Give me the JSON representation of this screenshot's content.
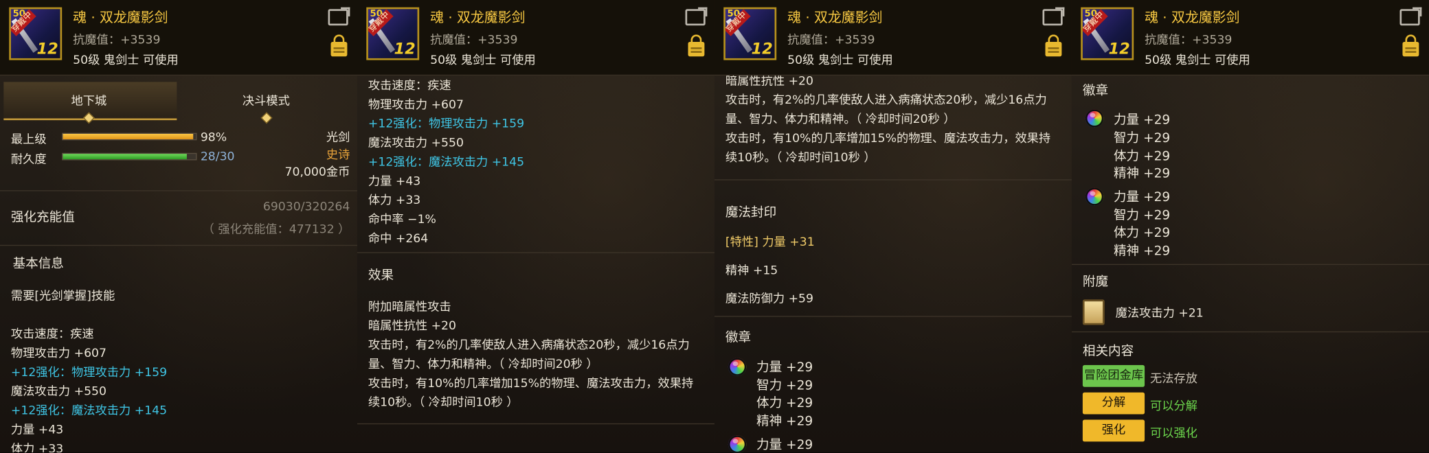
{
  "item": {
    "name": "魂 · 双龙魔影剑",
    "resist": "抗魔值：+3539",
    "requirement": "50级 鬼剑士 可使用",
    "icon_tag": "穿戴中",
    "icon_level": "12",
    "icon_req_level": "50"
  },
  "panel1": {
    "tabs": [
      "地下城",
      "决斗模式"
    ],
    "top_level_label": "最上级",
    "top_level_pct": "98%",
    "top_level_value": 0.98,
    "durability_label": "耐久度",
    "durability_text": "28/30",
    "durability_value": 0.933,
    "weapon_type": "光剑",
    "rarity": "史诗",
    "price": "70,000金币",
    "charge_label": "强化充能值",
    "charge_value": "69030/320264",
    "charge_total": "（ 强化充能值：477132 ）",
    "basic_info": "基本信息",
    "skill_req": "需要[光剑掌握]技能",
    "stats": [
      "攻击速度：疾速",
      "物理攻击力 +607",
      "+12强化：物理攻击力 +159",
      "魔法攻击力 +550",
      "+12强化：魔法攻击力 +145",
      "力量 +43",
      "体力 +33"
    ]
  },
  "panel2": {
    "stats": [
      "攻击速度：疾速",
      "物理攻击力 +607",
      "+12强化：物理攻击力 +159",
      "魔法攻击力 +550",
      "+12强化：魔法攻击力 +145",
      "力量 +43",
      "体力 +33",
      "命中率 −1%",
      "命中 +264"
    ],
    "effect_title": "效果",
    "effects": [
      "附加暗属性攻击",
      "暗属性抗性 +20",
      "攻击时，有2%的几率使敌人进入病痛状态20秒，减少16点力",
      "量、智力、体力和精神。（ 冷却时间20秒 ）",
      "攻击时，有10%的几率增加15%的物理、魔法攻击力，效果持",
      "续10秒。（ 冷却时间10秒 ）"
    ]
  },
  "panel3": {
    "effects": [
      "暗属性抗性 +20",
      "攻击时，有2%的几率使敌人进入病痛状态20秒，减少16点力",
      "量、智力、体力和精神。（ 冷却时间20秒 ）",
      "攻击时，有10%的几率增加15%的物理、魔法攻击力，效果持",
      "续10秒。（ 冷却时间10秒 ）"
    ],
    "seal_title": "魔法封印",
    "seal_trait": "[特性] 力量 +31",
    "seal_spirit": "精神 +15",
    "seal_mdef": "魔法防御力 +59",
    "emblem_title": "徽章",
    "emblem_stats": [
      "力量 +29",
      "智力 +29",
      "体力 +29",
      "精神 +29"
    ],
    "emblem2_first": "力量 +29"
  },
  "panel4": {
    "emblem_title": "徽章",
    "emblem1": [
      "力量 +29",
      "智力 +29",
      "体力 +29",
      "精神 +29"
    ],
    "emblem2": [
      "力量 +29",
      "智力 +29",
      "体力 +29",
      "精神 +29"
    ],
    "enchant_title": "附魔",
    "enchant": "魔法攻击力 +21",
    "related_title": "相关内容",
    "related": [
      {
        "button": "冒险团金库",
        "status": "无法存放"
      },
      {
        "button": "分解",
        "status": "可以分解"
      },
      {
        "button": "强化",
        "status": "可以强化"
      }
    ]
  },
  "colors": {
    "gold": "#f7c842",
    "cyan": "#3fc6e6",
    "green": "#6cc54c",
    "yellow": "#f0b82a"
  }
}
